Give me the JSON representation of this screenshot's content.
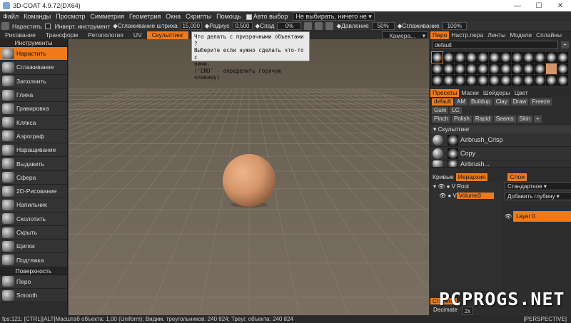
{
  "window": {
    "title": "3D-COAT 4.9.72(DX64)"
  },
  "menu": {
    "items": [
      "Файл",
      "Команды",
      "Просмотр",
      "Симметрия",
      "Геометрия",
      "Окна",
      "Скрипты",
      "Помощь"
    ],
    "auto_select": "Авто выбор",
    "select_mode": "Не выбирать, ничего не"
  },
  "toolbar": {
    "tool_name": "Нарастить",
    "invert": "Инверт. инструмент",
    "smooth_stroke": "Сглаживание штриха",
    "smooth_stroke_value": "15,000",
    "radius_label": "Радиус",
    "radius_value": "0,500",
    "falloff_label": "Спад",
    "falloff_value": "0%",
    "pressure_label": "Давление",
    "pressure_value": "50%",
    "smoothing_label": "Сглаживание",
    "smoothing_value": "100%",
    "camera": "Камера..."
  },
  "rooms": [
    "Рисование",
    "Трансформ",
    "Ретопология",
    "UV",
    "Скульптинг"
  ],
  "active_room": "Скульптинг",
  "tooltip": {
    "line1": "Что делать с призрачными объектами ?",
    "line2": "Выберите если нужно сделать что-то с",
    "line3": "ними.",
    "line4": "('END' - определить горячую клавишу)"
  },
  "left_panel": {
    "tools_header": "Инструменты",
    "tools": [
      "Нарастить",
      "Сглаживание",
      "Заполнить",
      "Глина",
      "Гравировка",
      "Клякса",
      "Аэрограф",
      "Наращивание",
      "Выдавить",
      "Сфера",
      "2D-Рисование",
      "Напильник",
      "Сколотить",
      "Скрыть",
      "Щипок",
      "Подтяжка"
    ],
    "active_tool": "Нарастить",
    "surface_header": "Поверхность",
    "surface_tools": [
      "Перо",
      "Smooth"
    ]
  },
  "right_panel": {
    "top_tabs": [
      "Перо",
      "Настр.пера",
      "Ленты",
      "Модели",
      "Сплайны"
    ],
    "brush_set": "default",
    "preset_tabs": [
      "Пресеты",
      "Маски",
      "Шейдеры",
      "Цвет"
    ],
    "preset_chips_row1": [
      "default",
      "AM",
      "Buildup",
      "Clay",
      "Draw",
      "Freeze",
      "Gum",
      "LC"
    ],
    "preset_chips_row2": [
      "Pinch",
      "Polish",
      "Rapid",
      "Seams",
      "Skin",
      "+"
    ],
    "sculpt_group": "Скульптинг",
    "presets": [
      "Airbrush_Crisp",
      "Copy",
      "Airbrush..."
    ],
    "curves_tab": "Кривые",
    "hierarchy_tab": "Иерархия",
    "layers_tab": "Слои",
    "root": "Root",
    "volume": "Volume3",
    "blend_mode": "Стандартное",
    "add_depth": "Добавить глубину",
    "layer_name": "Layer 0",
    "degree_tab": "Степень",
    "decimate": "Decimate",
    "decimate_value": "2x"
  },
  "status": {
    "text": "fps:121;        [CTRL][ALT]Масштаб объекта: 1,00 (Uniform); Видим. треугольников: 240 824; Треуг. объекта: 240 824",
    "perspective": "[PERSPECTIVE]"
  },
  "watermark": "PCPROGS.NET",
  "colors": {
    "accent": "#f07a1a",
    "background": "#2d2d2d",
    "sphere": "#d4956a"
  }
}
